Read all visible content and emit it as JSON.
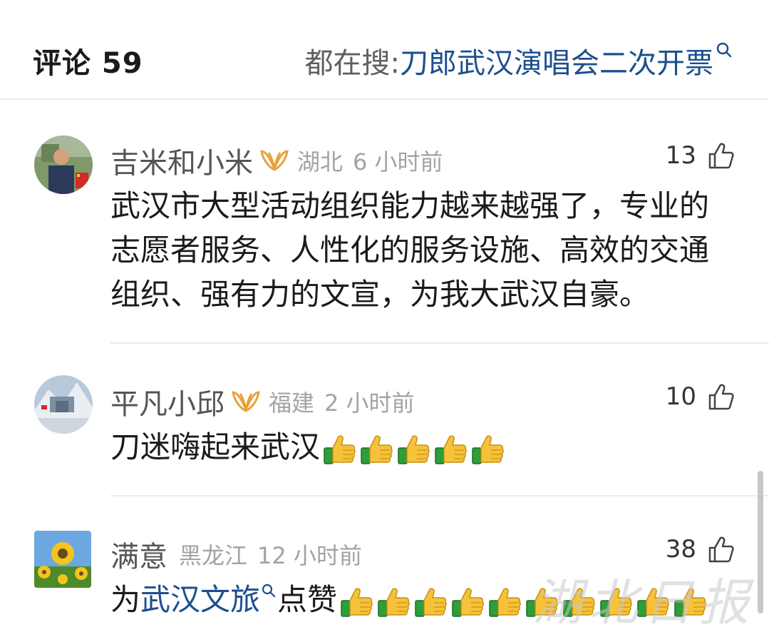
{
  "header": {
    "comment_label": "评论 59",
    "trending_prefix": "都在搜: ",
    "trending_term": "刀郎武汉演唱会二次开票"
  },
  "colors": {
    "link": "#1d4e8f",
    "badge": "#e8a23b",
    "meta": "#a3a3a3",
    "thumb_emoji": "#f6c23a",
    "cuff": "#2e9e3a"
  },
  "comments": [
    {
      "username": "吉米和小米",
      "vip": true,
      "location": "湖北",
      "time": "6 小时前",
      "likes": "13",
      "text": "武汉市大型活动组织能力越来越强了，专业的志愿者服务、人性化的服务设施、高效的交通组织、强有力的文宣，为我大武汉自豪。"
    },
    {
      "username": "平凡小邱",
      "vip": true,
      "location": "福建",
      "time": "2 小时前",
      "likes": "10",
      "text": "刀迷嗨起来武汉",
      "emoji_count": 5
    },
    {
      "username": "满意",
      "vip": false,
      "location": "黑龙江",
      "time": "12 小时前",
      "likes": "38",
      "text_before": "为",
      "link_text": "武汉文旅",
      "text_after": "点赞",
      "emoji_count": 10
    }
  ],
  "watermark": "湖北日报"
}
